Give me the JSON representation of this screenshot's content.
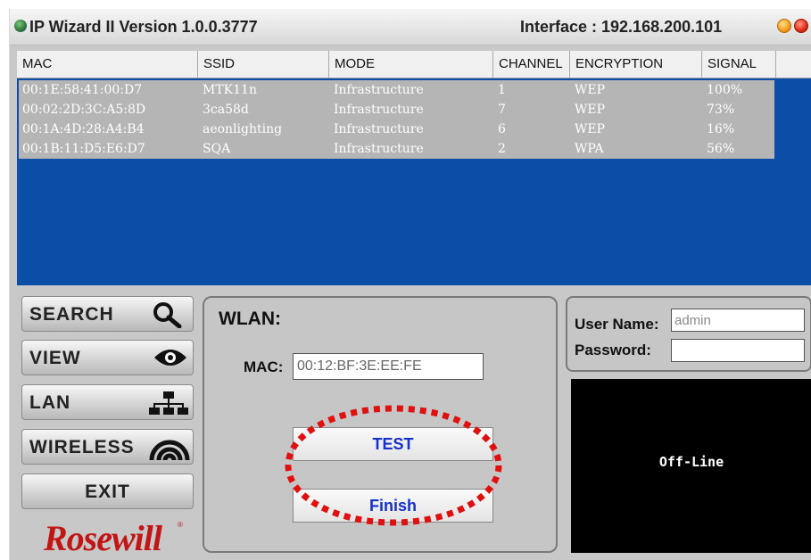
{
  "window": {
    "title": "IP Wizard II  Version 1.0.0.3777",
    "interface": "Interface : 192.168.200.101"
  },
  "networks": {
    "columns": [
      "MAC",
      "SSID",
      "MODE",
      "CHANNEL",
      "ENCRYPTION",
      "SIGNAL"
    ],
    "rows": [
      {
        "mac": "00:1E:58:41:00:D7",
        "ssid": "MTK11n",
        "mode": "Infrastructure",
        "channel": "1",
        "encryption": "WEP",
        "signal": "100%"
      },
      {
        "mac": "00:02:2D:3C:A5:8D",
        "ssid": "3ca58d",
        "mode": "Infrastructure",
        "channel": "7",
        "encryption": "WEP",
        "signal": "73%"
      },
      {
        "mac": "00:1A:4D:28:A4:B4",
        "ssid": "aeonlighting",
        "mode": "Infrastructure",
        "channel": "6",
        "encryption": "WEP",
        "signal": "16%"
      },
      {
        "mac": "00:1B:11:D5:E6:D7",
        "ssid": "SQA",
        "mode": "Infrastructure",
        "channel": "2",
        "encryption": "WPA",
        "signal": "56%"
      }
    ]
  },
  "nav": {
    "search": "SEARCH",
    "view": "VIEW",
    "lan": "LAN",
    "wireless": "WIRELESS",
    "exit": "EXIT"
  },
  "wlan": {
    "title": "WLAN:",
    "mac_label": "MAC:",
    "mac_value": "00:12:BF:3E:EE:FE",
    "test_label": "TEST",
    "finish_label": "Finish"
  },
  "login": {
    "username_label": "User Name:",
    "username_value": "admin",
    "password_label": "Password:",
    "password_value": ""
  },
  "status": {
    "text": "Off-Line"
  },
  "brand": {
    "logo_text": "Rosewill"
  },
  "colors": {
    "list_background": "#0b4ea8",
    "highlight_oval": "#e01010",
    "button_text": "#1531c9"
  }
}
